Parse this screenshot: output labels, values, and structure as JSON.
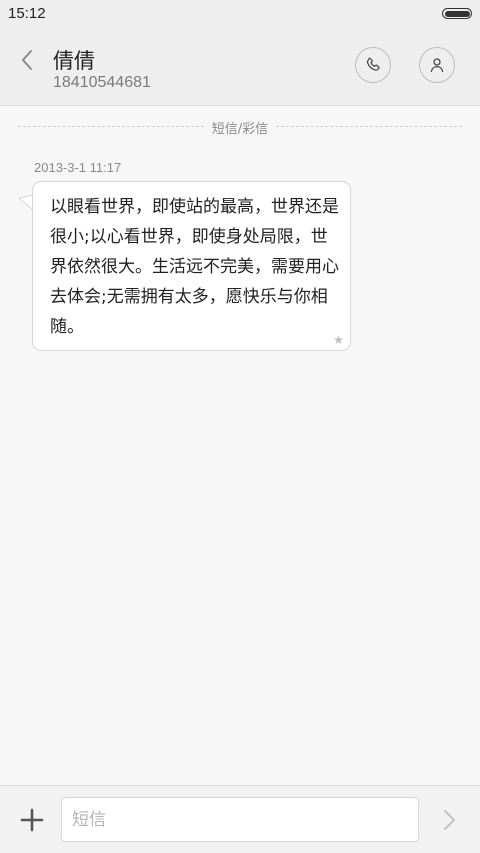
{
  "status_bar": {
    "time": "15:12"
  },
  "header": {
    "contact_name": "倩倩",
    "contact_number": "18410544681"
  },
  "conversation": {
    "message_type_label": "短信/彩信",
    "messages": [
      {
        "timestamp": "2013-3-1 11:17",
        "text": "以眼看世界，即使站的最高，世界还是很小;以心看世界，即使身处局限，世界依然很大。生活远不完美，需要用心去体会;无需拥有太多，愿快乐与你相随。",
        "starred": true
      }
    ]
  },
  "composer": {
    "placeholder": "短信",
    "value": ""
  },
  "colors": {
    "background": "#f7f7f7",
    "bar": "#eeeeee",
    "bubble": "#ffffff",
    "text_primary": "#222222",
    "text_secondary": "#8a8a8a"
  }
}
